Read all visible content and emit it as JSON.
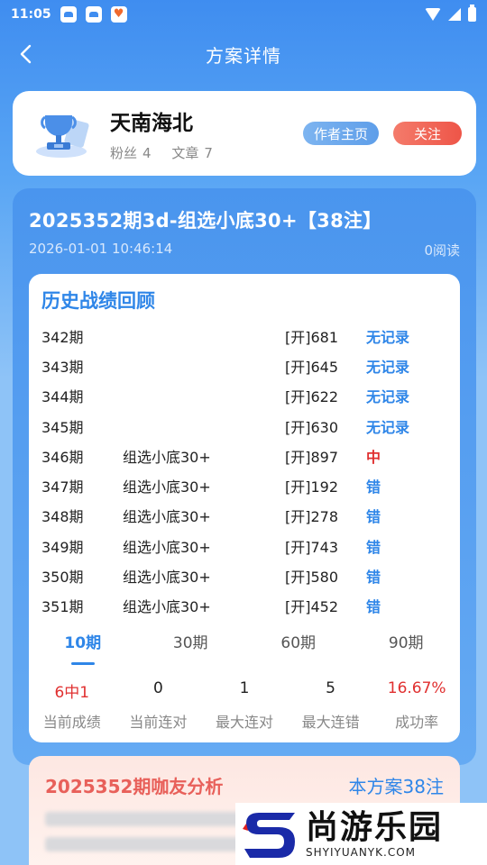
{
  "status_bar": {
    "time": "11:05"
  },
  "nav": {
    "title": "方案详情"
  },
  "author": {
    "name": "天南海北",
    "fans_label": "粉丝",
    "fans_count": "4",
    "articles_label": "文章",
    "articles_count": "7",
    "home_button": "作者主页",
    "follow_button": "关注"
  },
  "scheme": {
    "title": "2025352期3d-组选小底30+【38注】",
    "datetime": "2026-01-01 10:46:14",
    "reads": "0阅读"
  },
  "history": {
    "title": "历史战绩回顾",
    "rows": [
      {
        "period": "342期",
        "plan": "",
        "draw": "[开]681",
        "result": "无记录",
        "color": "blue"
      },
      {
        "period": "343期",
        "plan": "",
        "draw": "[开]645",
        "result": "无记录",
        "color": "blue"
      },
      {
        "period": "344期",
        "plan": "",
        "draw": "[开]622",
        "result": "无记录",
        "color": "blue"
      },
      {
        "period": "345期",
        "plan": "",
        "draw": "[开]630",
        "result": "无记录",
        "color": "blue"
      },
      {
        "period": "346期",
        "plan": "组选小底30+",
        "draw": "[开]897",
        "result": "中",
        "color": "red"
      },
      {
        "period": "347期",
        "plan": "组选小底30+",
        "draw": "[开]192",
        "result": "错",
        "color": "blue"
      },
      {
        "period": "348期",
        "plan": "组选小底30+",
        "draw": "[开]278",
        "result": "错",
        "color": "blue"
      },
      {
        "period": "349期",
        "plan": "组选小底30+",
        "draw": "[开]743",
        "result": "错",
        "color": "blue"
      },
      {
        "period": "350期",
        "plan": "组选小底30+",
        "draw": "[开]580",
        "result": "错",
        "color": "blue"
      },
      {
        "period": "351期",
        "plan": "组选小底30+",
        "draw": "[开]452",
        "result": "错",
        "color": "blue"
      }
    ],
    "tabs": [
      "10期",
      "30期",
      "60期",
      "90期"
    ],
    "active_tab": 0,
    "stats": [
      {
        "value": "6中1",
        "label": "当前成绩",
        "color": "red"
      },
      {
        "value": "0",
        "label": "当前连对",
        "color": "default"
      },
      {
        "value": "1",
        "label": "最大连对",
        "color": "default"
      },
      {
        "value": "5",
        "label": "最大连错",
        "color": "default"
      },
      {
        "value": "16.67%",
        "label": "成功率",
        "color": "red"
      }
    ]
  },
  "analysis": {
    "title": "2025352期咖友分析",
    "count": "本方案38注"
  },
  "watermark": {
    "cn": "尚游乐园",
    "en": "SHYIYUANYK.COM"
  },
  "colors": {
    "accent": "#2f86e8",
    "red": "#e03030",
    "follow": "#ee5548"
  }
}
